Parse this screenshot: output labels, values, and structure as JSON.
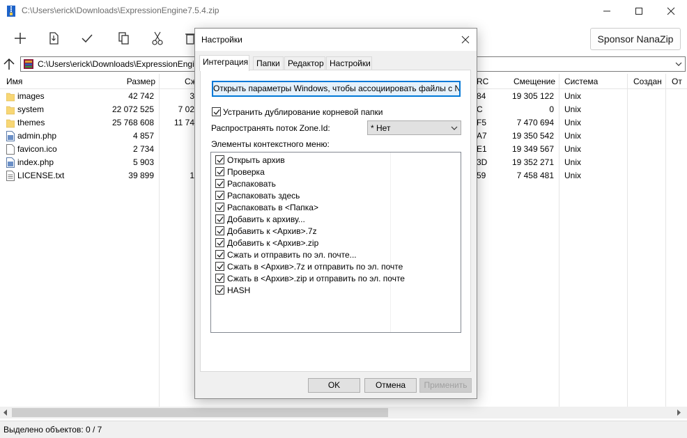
{
  "window": {
    "title": "C:\\Users\\erick\\Downloads\\ExpressionEngine7.5.4.zip"
  },
  "toolbar": {
    "sponsor_label": "Sponsor NanaZip"
  },
  "address": {
    "path": "C:\\Users\\erick\\Downloads\\ExpressionEngine7.5.4.zip\\"
  },
  "columns": {
    "name": "Имя",
    "size": "Размер",
    "packed": "Сж",
    "crc": "RC",
    "offset": "Смещение",
    "system": "Система",
    "created": "Создан",
    "more": "От"
  },
  "files": [
    {
      "name": "images",
      "size": "42 742",
      "packed": "3",
      "crc": "84",
      "offset": "19 305 122",
      "system": "Unix",
      "type": "folder"
    },
    {
      "name": "system",
      "size": "22 072 525",
      "packed": "7 02",
      "crc": "C",
      "offset": "0",
      "system": "Unix",
      "type": "folder"
    },
    {
      "name": "themes",
      "size": "25 768 608",
      "packed": "11 74",
      "crc": "F5",
      "offset": "7 470 694",
      "system": "Unix",
      "type": "folder"
    },
    {
      "name": "admin.php",
      "size": "4 857",
      "packed": "",
      "crc": "A7",
      "offset": "19 350 542",
      "system": "Unix",
      "type": "php"
    },
    {
      "name": "favicon.ico",
      "size": "2 734",
      "packed": "",
      "crc": "E1",
      "offset": "19 349 567",
      "system": "Unix",
      "type": "file"
    },
    {
      "name": "index.php",
      "size": "5 903",
      "packed": "",
      "crc": "3D",
      "offset": "19 352 271",
      "system": "Unix",
      "type": "php"
    },
    {
      "name": "LICENSE.txt",
      "size": "39 899",
      "packed": "1",
      "crc": "59",
      "offset": "7 458 481",
      "system": "Unix",
      "type": "txt"
    }
  ],
  "status": {
    "selected": "Выделено объектов: 0 / 7"
  },
  "dialog": {
    "title": "Настройки",
    "tabs": [
      "Интеграция",
      "Папки",
      "Редактор",
      "Настройки"
    ],
    "assoc_button": "Открыть параметры Windows, чтобы ассоциировать файлы с NanaZip",
    "eliminate_dup_label": "Устранить дублирование корневой папки",
    "zone_label": "Распространять поток Zone.Id:",
    "zone_value": "* Нет",
    "context_label": "Элементы контекстного меню:",
    "context_items": [
      "Открыть архив",
      "Проверка",
      "Распаковать",
      "Распаковать здесь",
      "Распаковать в <Папка>",
      "Добавить к архиву...",
      "Добавить к <Архив>.7z",
      "Добавить к <Архив>.zip",
      "Сжать и отправить по эл. почте...",
      "Сжать в <Архив>.7z и отправить по эл. почте",
      "Сжать в <Архив>.zip и отправить по эл. почте",
      "HASH"
    ],
    "ok_label": "OK",
    "cancel_label": "Отмена",
    "apply_label": "Применить"
  },
  "colors": {
    "accent": "#0078d7",
    "folder": "#f8d775",
    "dialog_bg": "#f0f0f0"
  }
}
